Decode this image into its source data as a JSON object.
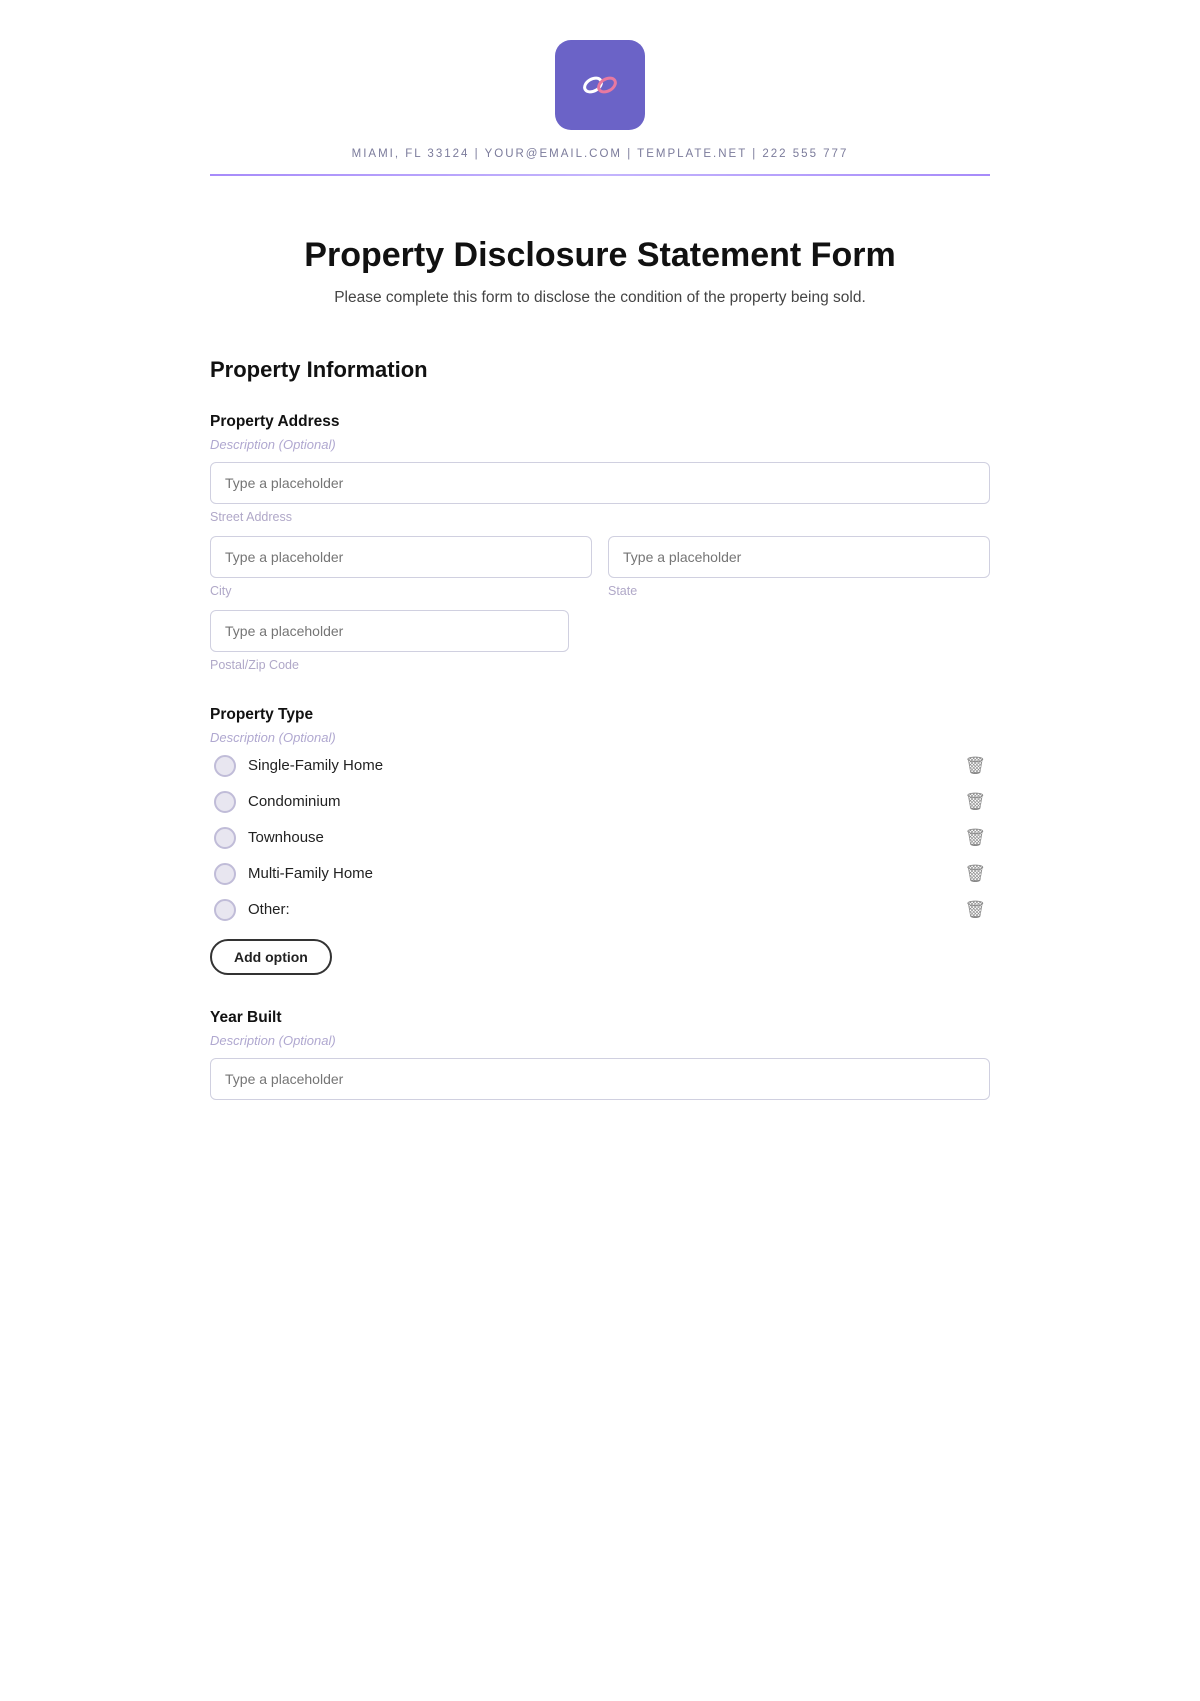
{
  "header": {
    "logo_alt": "Template.net Logo",
    "contact_text": "MIAMI, FL 33124 | YOUR@EMAIL.COM | TEMPLATE.NET | 222 555 777"
  },
  "form": {
    "title": "Property Disclosure Statement Form",
    "subtitle": "Please complete this form to disclose the condition of the property being sold.",
    "section_title": "Property Information",
    "fields": {
      "property_address": {
        "label": "Property Address",
        "description": "Description (Optional)",
        "street": {
          "placeholder": "Type a placeholder",
          "sub_label": "Street Address"
        },
        "city": {
          "placeholder": "Type a placeholder",
          "sub_label": "City"
        },
        "state": {
          "placeholder": "Type a placeholder",
          "sub_label": "State"
        },
        "postal": {
          "placeholder": "Type a placeholder",
          "sub_label": "Postal/Zip Code"
        }
      },
      "property_type": {
        "label": "Property Type",
        "description": "Description (Optional)",
        "options": [
          "Single-Family Home",
          "Condominium",
          "Townhouse",
          "Multi-Family Home",
          "Other:"
        ],
        "add_option_label": "Add option"
      },
      "year_built": {
        "label": "Year Built",
        "description": "Description (Optional)",
        "placeholder": "Type a placeholder"
      }
    }
  }
}
